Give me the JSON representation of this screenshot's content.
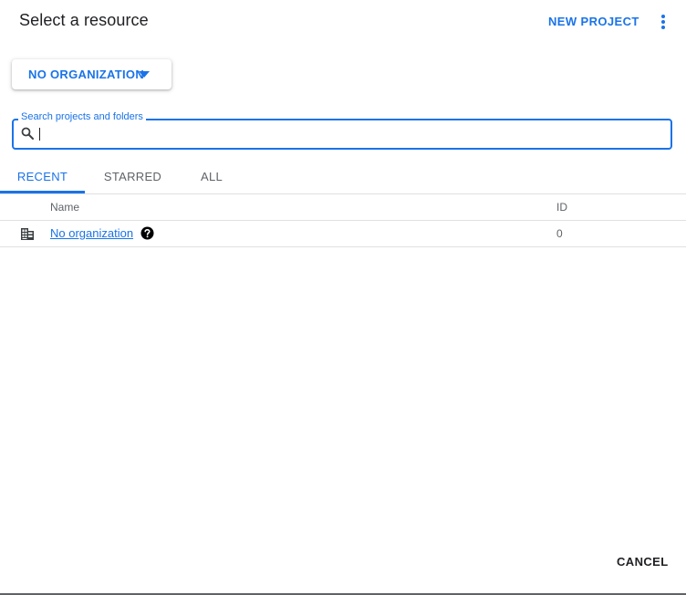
{
  "header": {
    "title": "Select a resource",
    "new_project_label": "NEW PROJECT",
    "more_icon": "more-vert-icon"
  },
  "organization_selector": {
    "selected": "NO ORGANIZATION",
    "icon": "arrow-drop-down-icon"
  },
  "search": {
    "label": "Search projects and folders",
    "value": "",
    "icon": "search-icon"
  },
  "tabs": [
    {
      "label": "RECENT",
      "active": true
    },
    {
      "label": "STARRED",
      "active": false
    },
    {
      "label": "ALL",
      "active": false
    }
  ],
  "table": {
    "columns": [
      "Name",
      "ID"
    ],
    "rows": [
      {
        "icon": "building-icon",
        "name": "No organization",
        "help_icon": "help-icon",
        "id": "0"
      }
    ]
  },
  "footer": {
    "cancel_label": "CANCEL"
  },
  "colors": {
    "accent": "#1a73e8",
    "text": "#202124",
    "muted": "#5f6368",
    "divider": "#e0e0e0"
  }
}
